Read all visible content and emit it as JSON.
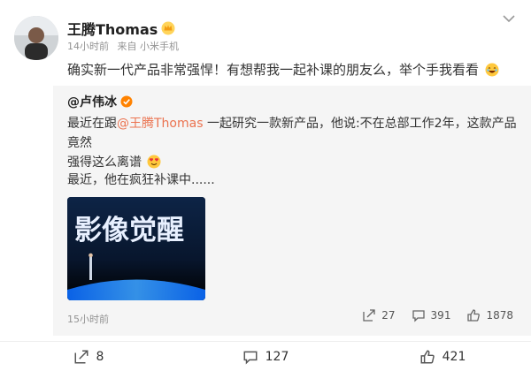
{
  "author": {
    "name": "王腾Thomas",
    "time": "14小时前",
    "source": "来自 小米手机"
  },
  "post": {
    "text": "确实新一代产品非常强悍！有想帮我一起补课的朋友么，举个手我看看"
  },
  "repost": {
    "author": "@卢伟冰",
    "line1_prefix": "最近在跟",
    "mention": "@王腾Thomas",
    "line1_suffix": " 一起研究一款新产品，他说:不在总部工作2年，这款产品竟然",
    "line2": "强得这么离谱",
    "text2": "最近，他在疯狂补课中......",
    "image_text": "影像觉醒",
    "time": "15小时前",
    "actions": {
      "share": "27",
      "comment": "391",
      "like": "1878"
    }
  },
  "footer": {
    "share": "8",
    "comment": "127",
    "like": "421"
  },
  "colors": {
    "mention": "#eb7350",
    "meta": "#939393",
    "repost_bg": "#f5f5f5"
  },
  "icons": [
    "crown-icon",
    "more-chevron-icon",
    "laugh-emoji-icon",
    "verified-badge-icon",
    "heart-eyes-emoji-icon",
    "share-icon",
    "comment-icon",
    "like-icon"
  ]
}
